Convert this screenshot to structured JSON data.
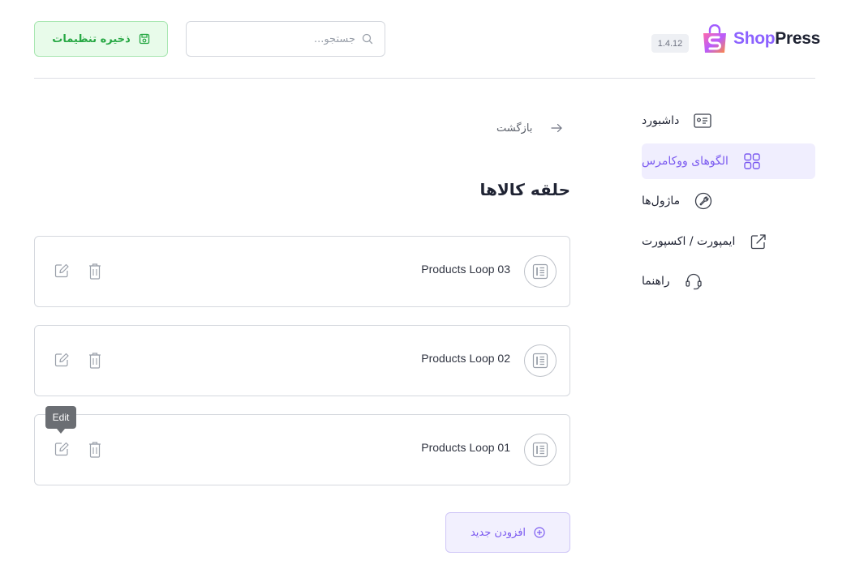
{
  "header": {
    "brand_part1": "Shop",
    "brand_part2": "Press",
    "version": "1.4.12",
    "search_placeholder": "جستجو...",
    "search_value": "",
    "save_label": "ذخیره تنظیمات",
    "save_icon": "floppy-disk-icon",
    "search_icon": "search-icon"
  },
  "sidebar": {
    "items": [
      {
        "label": "داشبورد",
        "icon": "dashboard-card-icon",
        "active": false
      },
      {
        "label": "الگوهای ووکامرس",
        "icon": "grid-icon",
        "active": true
      },
      {
        "label": "ماژول‌ها",
        "icon": "wrench-circle-icon",
        "active": false
      },
      {
        "label": "ایمپورت / اکسپورت",
        "icon": "export-icon",
        "active": false
      },
      {
        "label": "راهنما",
        "icon": "headset-icon",
        "active": false
      }
    ]
  },
  "main": {
    "back_label": "بازگشت",
    "title": "حلقه کالاها",
    "templates": [
      {
        "name": "Products Loop 03"
      },
      {
        "name": "Products Loop 02"
      },
      {
        "name": "Products Loop 01"
      }
    ],
    "tooltip": "Edit",
    "add_label": "افزودن جدید"
  },
  "colors": {
    "accent": "#7b5af0",
    "active_bg": "#f0eefe",
    "save_green": "#27a844",
    "save_bg": "#e8fbea"
  }
}
